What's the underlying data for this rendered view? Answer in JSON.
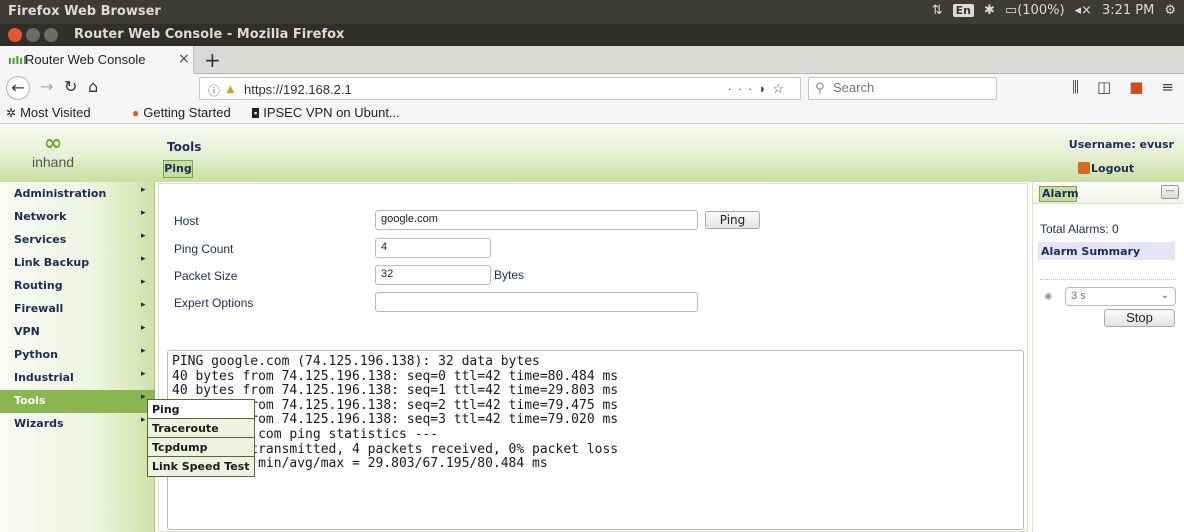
{
  "os_panel": {
    "app_name": "Firefox Web Browser",
    "lang": "En",
    "battery": "(100%)",
    "time": "3:21 PM"
  },
  "window": {
    "title": "Router Web Console - Mozilla Firefox"
  },
  "tab": {
    "label": "Router Web Console"
  },
  "nav": {
    "url": "https://192.168.2.1",
    "search_placeholder": "Search"
  },
  "bookmarks": [
    {
      "label": "Most Visited"
    },
    {
      "label": "Getting Started"
    },
    {
      "label": "IPSEC VPN on Ubunt..."
    }
  ],
  "header": {
    "logo_text": "inhand",
    "page_title": "Tools",
    "subtab": "Ping",
    "username": "Username: evusr",
    "logout": "Logout"
  },
  "sidebar": {
    "items": [
      {
        "label": "Administration"
      },
      {
        "label": "Network"
      },
      {
        "label": "Services"
      },
      {
        "label": "Link Backup"
      },
      {
        "label": "Routing"
      },
      {
        "label": "Firewall"
      },
      {
        "label": "VPN"
      },
      {
        "label": "Python"
      },
      {
        "label": "Industrial"
      },
      {
        "label": "Tools"
      },
      {
        "label": "Wizards"
      }
    ],
    "active": "Tools"
  },
  "flyout": {
    "items": [
      {
        "label": "Ping"
      },
      {
        "label": "Traceroute"
      },
      {
        "label": "Tcpdump"
      },
      {
        "label": "Link Speed Test"
      }
    ]
  },
  "form": {
    "host_label": "Host",
    "host_value": "google.com",
    "ping_button": "Ping",
    "count_label": "Ping Count",
    "count_value": "4",
    "size_label": "Packet Size",
    "size_value": "32",
    "size_unit": "Bytes",
    "expert_label": "Expert Options",
    "expert_value": ""
  },
  "output": {
    "lines": [
      "PING google.com (74.125.196.138): 32 data bytes",
      "40 bytes from 74.125.196.138: seq=0 ttl=42 time=80.484 ms",
      "40 bytes from 74.125.196.138: seq=1 ttl=42 time=29.803 ms",
      "40 bytes from 74.125.196.138: seq=2 ttl=42 time=79.475 ms",
      "40 bytes from 74.125.196.138: seq=3 ttl=42 time=79.020 ms",
      "",
      "--- google.com ping statistics ---",
      "4 packets transmitted, 4 packets received, 0% packet loss",
      "round-trip min/avg/max = 29.803/67.195/80.484 ms"
    ]
  },
  "alarm": {
    "tab": "Alarm",
    "total": "Total Alarms: 0",
    "summary": "Alarm Summary",
    "interval": "3 s",
    "stop_button": "Stop"
  },
  "colors": {
    "accent_green": "#8ab64f",
    "nav_text": "#1b2d5a"
  }
}
